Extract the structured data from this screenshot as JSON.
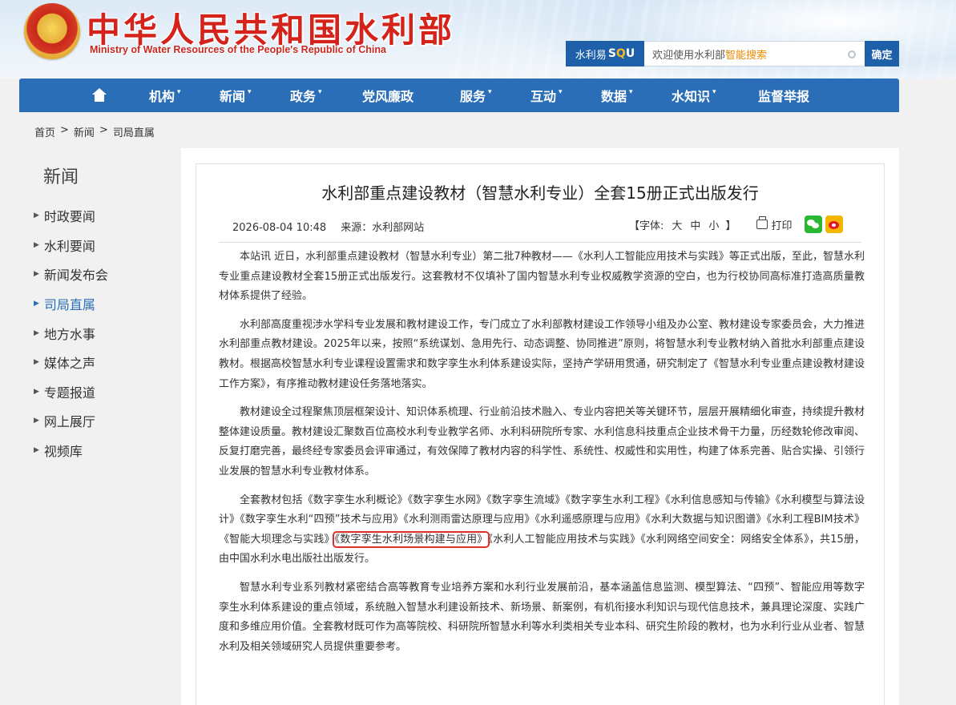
{
  "header": {
    "title_cn": "中华人民共和国水利部",
    "title_en": "Ministry of Water Resources of the People's Republic of China",
    "search": {
      "brand_prefix": "水利易",
      "brand_s": "S",
      "brand_q": "Q",
      "brand_u": "U",
      "placeholder_prefix": "欢迎使用水利部",
      "placeholder_highlight": "智能搜索",
      "button": "确定"
    }
  },
  "nav": {
    "items": [
      {
        "label": "机构",
        "has_dropdown": true
      },
      {
        "label": "新闻",
        "has_dropdown": true
      },
      {
        "label": "政务",
        "has_dropdown": true
      },
      {
        "label": "党风廉政",
        "has_dropdown": false
      },
      {
        "label": "服务",
        "has_dropdown": true
      },
      {
        "label": "互动",
        "has_dropdown": true
      },
      {
        "label": "数据",
        "has_dropdown": true
      },
      {
        "label": "水知识",
        "has_dropdown": true
      },
      {
        "label": "监督举报",
        "has_dropdown": false
      }
    ],
    "caret": "▾"
  },
  "breadcrumb": {
    "items": [
      "首页",
      "新闻",
      "司局直属"
    ],
    "separator": ">"
  },
  "sidebar": {
    "title": "新闻",
    "items": [
      {
        "label": "时政要闻",
        "active": false
      },
      {
        "label": "水利要闻",
        "active": false
      },
      {
        "label": "新闻发布会",
        "active": false
      },
      {
        "label": "司局直属",
        "active": true
      },
      {
        "label": "地方水事",
        "active": false
      },
      {
        "label": "媒体之声",
        "active": false
      },
      {
        "label": "专题报道",
        "active": false
      },
      {
        "label": "网上展厅",
        "active": false
      },
      {
        "label": "视频库",
        "active": false
      }
    ]
  },
  "article": {
    "title": "水利部重点建设教材（智慧水利专业）全套15册正式出版发行",
    "date": "2026-08-04 10:48",
    "source": "来源：水利部网站",
    "font_label": "【字体:",
    "font_large": "大",
    "font_medium": "中",
    "font_small": "小",
    "font_close": "】",
    "print_label": "打印",
    "paragraphs": [
      "本站讯 近日，水利部重点建设教材（智慧水利专业）第二批7种教材——《水利人工智能应用技术与实践》等正式出版，至此，智慧水利专业重点建设教材全套15册正式出版发行。这套教材不仅填补了国内智慧水利专业权威教学资源的空白，也为行校协同高标准打造高质量教材体系提供了经验。",
      "水利部高度重视涉水学科专业发展和教材建设工作，专门成立了水利部教材建设工作领导小组及办公室、教材建设专家委员会，大力推进水利部重点教材建设。2025年以来，按照“系统谋划、急用先行、动态调整、协同推进”原则，将智慧水利专业教材纳入首批水利部重点建设教材。根据高校智慧水利专业课程设置需求和数字孪生水利体系建设实际，坚持产学研用贯通，研究制定了《智慧水利专业重点建设教材建设工作方案》，有序推动教材建设任务落地落实。",
      "教材建设全过程聚焦顶层框架设计、知识体系梳理、行业前沿技术融入、专业内容把关等关键环节，层层开展精细化审查，持续提升教材整体建设质量。教材建设汇聚数百位高校水利专业教学名师、水利科研院所专家、水利信息科技重点企业技术骨干力量，历经数轮修改审阅、反复打磨完善，最终经专家委员会评审通过，有效保障了教材内容的科学性、系统性、权威性和实用性，构建了体系完善、贴合实操、引领行业发展的智慧水利专业教材体系。",
      "智慧水利专业系列教材紧密结合高等教育专业培养方案和水利行业发展前沿，基本涵盖信息监测、模型算法、“四预”、智能应用等数字孪生水利体系建设的重点领域，系统融入智慧水利建设新技术、新场景、新案例，有机衔接水利知识与现代信息技术，兼具理论深度、实践广度和多维应用价值。全套教材既可作为高等院校、科研院所智慧水利等水利类相关专业本科、研究生阶段的教材，也为水利行业从业者、智慧水利及相关领域研究人员提供重要参考。"
    ],
    "books_paragraph": {
      "before": "全套教材包括《数字孪生水利概论》《数字孪生水网》《数字孪生流域》《数字孪生水利工程》《水利信息感知与传输》《水利模型与算法设计》《数字孪生水利“四预”技术与应用》《水利测雨雷达原理与应用》《水利遥感原理与应用》《水利大数据与知识图谱》《水利工程BIM技术》《智能大坝理念与实践》",
      "highlighted": "《数字孪生水利场景构建与应用》",
      "after": "《水利人工智能应用技术与实践》《水利网络空间安全：网络安全体系》，共15册，由中国水利水电出版社出版发行。"
    }
  },
  "colors": {
    "nav_bg": "#2a6eb8",
    "title_red": "#d4231b",
    "search_blue": "#1d5fa8",
    "active_link": "#2a6eb8",
    "highlight_box": "#e0302a"
  }
}
